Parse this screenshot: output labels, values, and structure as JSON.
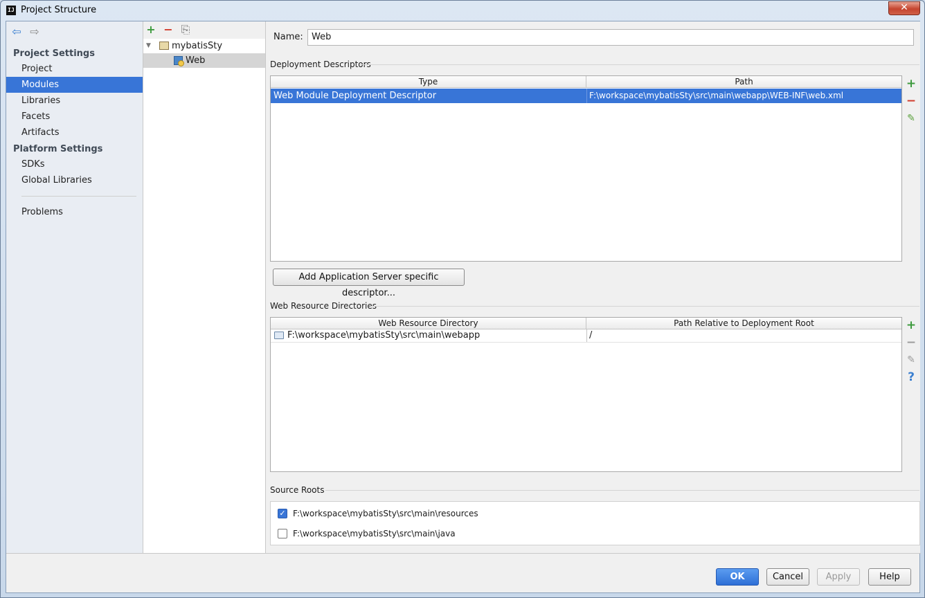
{
  "window": {
    "title": "Project Structure",
    "close_glyph": "✕",
    "app_icon_text": "IJ"
  },
  "nav": {
    "back_glyph": "⇦",
    "forward_glyph": "⇨"
  },
  "sidebar": {
    "project_settings_header": "Project Settings",
    "platform_settings_header": "Platform Settings",
    "items": [
      {
        "label": "Project"
      },
      {
        "label": "Modules",
        "selected": true
      },
      {
        "label": "Libraries"
      },
      {
        "label": "Facets"
      },
      {
        "label": "Artifacts"
      },
      {
        "label": "SDKs"
      },
      {
        "label": "Global Libraries"
      },
      {
        "label": "Problems"
      }
    ]
  },
  "tree": {
    "toolbar": {
      "add_glyph": "+",
      "remove_glyph": "−",
      "copy_glyph": "⎘"
    },
    "root": {
      "label": "mybatisSty",
      "expanded_glyph": "▼"
    },
    "child": {
      "label": "Web",
      "selected": true
    }
  },
  "main": {
    "name_label": "Name:",
    "name_value": "Web",
    "deployment": {
      "title": "Deployment Descriptors",
      "columns": [
        "Type",
        "Path"
      ],
      "rows": [
        {
          "type": "Web Module Deployment Descriptor",
          "path": "F:\\workspace\\mybatisSty\\src\\main\\webapp\\WEB-INF\\web.xml",
          "selected": true
        }
      ],
      "add_server_button": "Add Application Server specific descriptor..."
    },
    "web_resources": {
      "title": "Web Resource Directories",
      "columns": [
        "Web Resource Directory",
        "Path Relative to Deployment Root"
      ],
      "rows": [
        {
          "directory": "F:\\workspace\\mybatisSty\\src\\main\\webapp",
          "relative": "/"
        }
      ]
    },
    "side_tools": {
      "add": "+",
      "remove": "−",
      "edit": "✎",
      "help": "?"
    },
    "source_roots": {
      "title": "Source Roots",
      "items": [
        {
          "path": "F:\\workspace\\mybatisSty\\src\\main\\resources",
          "checked": true
        },
        {
          "path": "F:\\workspace\\mybatisSty\\src\\main\\java",
          "checked": false
        }
      ],
      "check_glyph": "✓"
    }
  },
  "footer": {
    "ok": "OK",
    "cancel": "Cancel",
    "apply": "Apply",
    "help": "Help"
  },
  "colors": {
    "selection": "#3875d7",
    "add_green": "#3d9a3d",
    "remove_red": "#d13a2a",
    "edit_green": "#5aa03c",
    "help_blue": "#3a7fd0"
  }
}
